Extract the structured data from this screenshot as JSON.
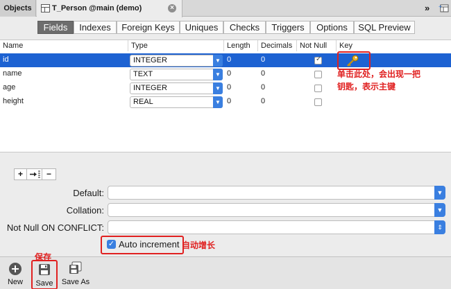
{
  "tabs": {
    "objects": "Objects",
    "document": "T_Person @main (demo)",
    "close": "×",
    "more": "»"
  },
  "segments": [
    "Fields",
    "Indexes",
    "Foreign Keys",
    "Uniques",
    "Checks",
    "Triggers",
    "Options",
    "SQL Preview"
  ],
  "active_segment": "Fields",
  "grid": {
    "headers": [
      "Name",
      "Type",
      "Length",
      "Decimals",
      "Not Null",
      "Key"
    ],
    "rows": [
      {
        "name": "id",
        "type": "INTEGER",
        "length": "0",
        "decimals": "0",
        "not_null": true,
        "key": true
      },
      {
        "name": "name",
        "type": "TEXT",
        "length": "0",
        "decimals": "0",
        "not_null": false,
        "key": false
      },
      {
        "name": "age",
        "type": "INTEGER",
        "length": "0",
        "decimals": "0",
        "not_null": false,
        "key": false
      },
      {
        "name": "height",
        "type": "REAL",
        "length": "0",
        "decimals": "0",
        "not_null": false,
        "key": false
      }
    ]
  },
  "annotations": {
    "key_note_line1": "单击此处，会出现一把",
    "key_note_line2": "钥匙，表示主键",
    "auto_note": "自动增长",
    "save_note": "保存"
  },
  "row_buttons": {
    "add": "+",
    "insert": "→",
    "remove": "−"
  },
  "form": {
    "default_label": "Default:",
    "default_value": "",
    "collation_label": "Collation:",
    "collation_value": "",
    "notnull_conflict_label": "Not Null ON CONFLICT:",
    "notnull_conflict_value": "",
    "auto_increment_label": "Auto increment",
    "auto_increment_checked": true
  },
  "toolbar": {
    "new_label": "New",
    "save_label": "Save",
    "save_as_label": "Save As"
  },
  "colors": {
    "selection": "#1d62d2",
    "accent": "#3a7fe0",
    "annotation": "#e02020"
  }
}
